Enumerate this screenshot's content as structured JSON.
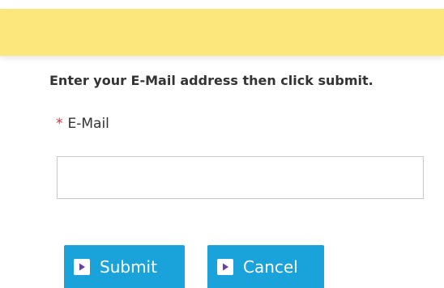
{
  "banner": {
    "color": "#fbe77c"
  },
  "form": {
    "instruction": "Enter your E-Mail address then click submit.",
    "email_label": "E-Mail",
    "required_marker": "*",
    "email_value": "",
    "email_placeholder": ""
  },
  "buttons": {
    "submit_label": "Submit",
    "cancel_label": "Cancel",
    "icon": "play-icon",
    "color": "#1aa3da"
  }
}
